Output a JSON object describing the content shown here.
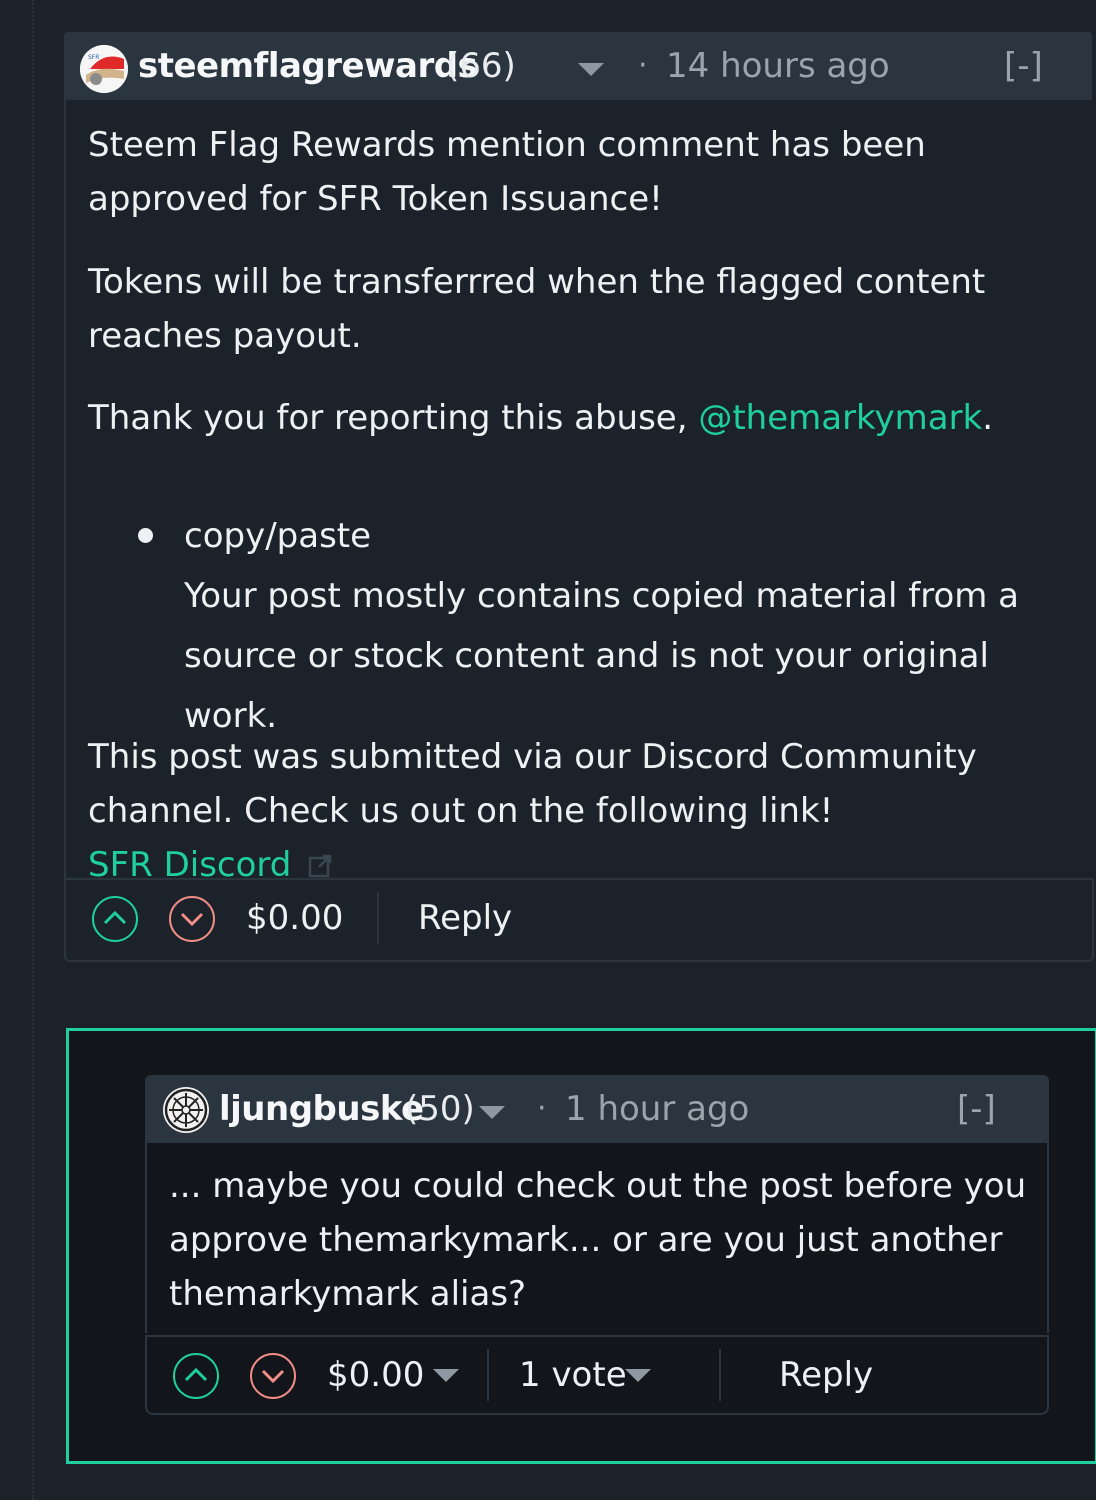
{
  "comment": {
    "author": "steemflagrewards",
    "reputation": "(66)",
    "time": "14 hours ago",
    "collapse_label": "[-]",
    "paragraphs": [
      "Steem Flag Rewards mention comment has been approved for SFR Token Issuance!",
      "Tokens will be transferrred when the flagged content reaches payout."
    ],
    "thanks_text": "Thank you for reporting this abuse, ",
    "thanks_mention": "@themarkymark",
    "thanks_end": ".",
    "bullet_title": "copy/paste",
    "bullet_detail": "Your post mostly contains copied material from a source or stock content and is not your original work.",
    "discord_text": "This post was submitted via our Discord Community channel. Check us out on the following link!",
    "discord_link": "SFR Discord",
    "payout": "$0.00",
    "reply_label": "Reply"
  },
  "reply": {
    "author": "ljungbuske",
    "reputation": "(50)",
    "time": "1 hour ago",
    "collapse_label": "[-]",
    "body": "... maybe you could check out the post before you approve themarkymark... or are you just another themarkymark alias?",
    "payout": "$0.00",
    "votes": "1 vote",
    "reply_label": "Reply"
  },
  "colors": {
    "accent": "#1fcf9e",
    "downvote": "#f08d86",
    "background": "#1b2229",
    "header": "#2b3540"
  },
  "icons": {
    "upvote": "chevron-up-circle-icon",
    "downvote": "chevron-down-circle-icon",
    "dropdown": "caret-down-icon",
    "external": "external-link-icon"
  }
}
